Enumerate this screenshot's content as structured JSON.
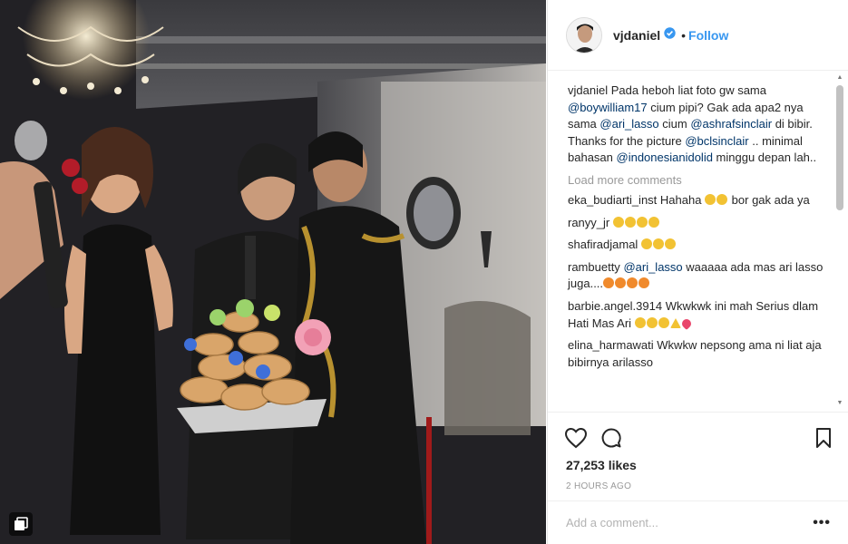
{
  "post": {
    "username": "vjdaniel",
    "follow_label": "Follow",
    "dot": "•",
    "verified_icon": "verified-badge-icon",
    "caption": {
      "user": "vjdaniel",
      "parts": [
        {
          "t": " Pada heboh liat foto gw sama "
        },
        {
          "m": "@boywilliam17"
        },
        {
          "t": " cium pipi? Gak ada apa2 nya sama "
        },
        {
          "m": "@ari_lasso"
        },
        {
          "t": " cium "
        },
        {
          "m": "@ashrafsinclair"
        },
        {
          "t": " di bibir. Thanks for the picture "
        },
        {
          "m": "@bclsinclair"
        },
        {
          "t": " .. minimal bahasan "
        },
        {
          "m": "@indonesianidolid"
        },
        {
          "t": " minggu depan lah.."
        }
      ]
    },
    "load_more": "Load more comments",
    "comments": [
      {
        "user": "eka_budiarti_inst",
        "text": " Hahaha ",
        "emojis": [
          "grin",
          "grin"
        ],
        "after": " bor gak ada ya"
      },
      {
        "user": "ranyy_jr",
        "text": " ",
        "emojis": [
          "grin",
          "grin",
          "grin",
          "grin"
        ],
        "after": ""
      },
      {
        "user": "shafiradjamal",
        "text": " ",
        "emojis": [
          "grin",
          "grin",
          "grin"
        ],
        "after": ""
      },
      {
        "user": "rambuetty",
        "text": " ",
        "mention": "@ari_lasso",
        "text2": " waaaaa ada mas ari lasso juga....",
        "emojis": [
          "eyes",
          "eyes",
          "eyes",
          "eyes"
        ],
        "after": ""
      },
      {
        "user": "barbie.angel.3914",
        "text": " Wkwkwk ini mah Serius dlam Hati Mas Ari ",
        "emojis": [
          "grin",
          "grin",
          "grin",
          "tri",
          "heart"
        ],
        "after": ""
      },
      {
        "user": "elina_harmawati",
        "text": " Wkwkw nepsong ama ni liat aja bibirnya arilasso",
        "emojis": [],
        "after": ""
      }
    ],
    "likes": "27,253 likes",
    "time": "2 HOURS AGO",
    "comment_placeholder": "Add a comment...",
    "more_label": "•••",
    "colors": {
      "accent": "#3897f0",
      "mention": "#003569",
      "muted": "#999999"
    }
  },
  "icons": {
    "like": "heart-icon",
    "comment": "comment-icon",
    "save": "bookmark-icon",
    "multi": "carousel-icon"
  }
}
